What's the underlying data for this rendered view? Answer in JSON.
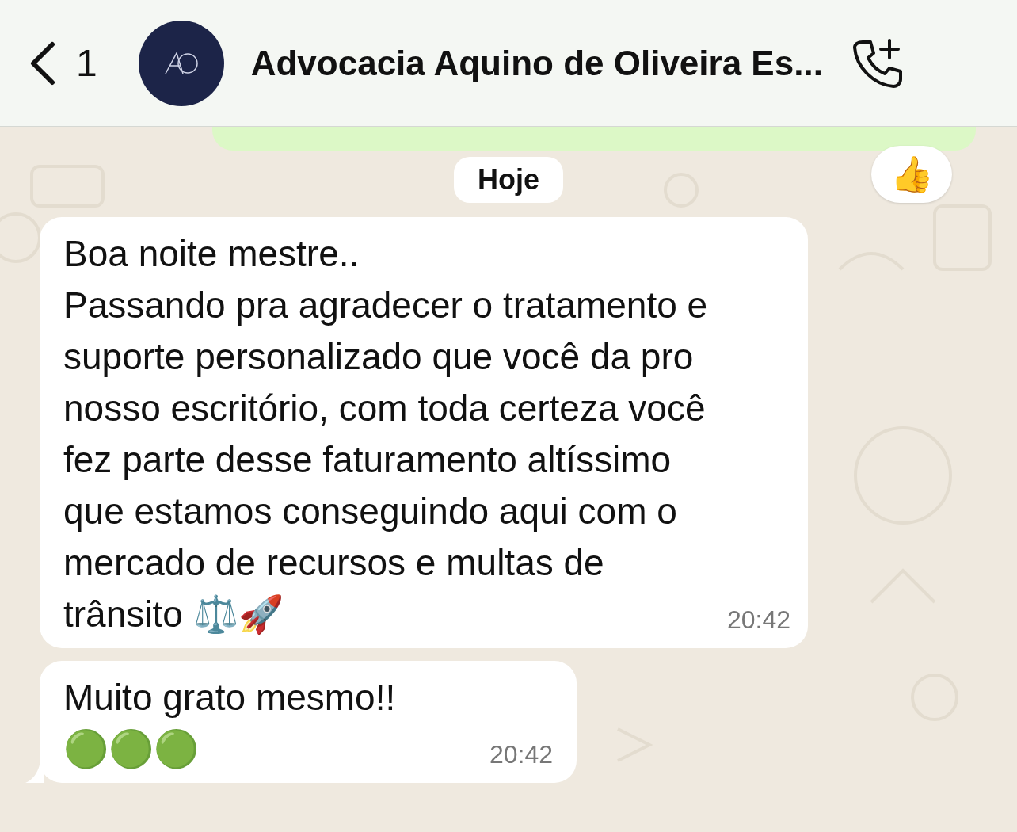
{
  "header": {
    "back_count": "1",
    "title": "Advocacia Aquino de Oliveira Es..."
  },
  "date_chip": "Hoje",
  "messages": [
    {
      "lines": [
        "Boa noite mestre..",
        "Passando pra agradecer o tratamento e suporte personalizado que você da pro nosso escritório, com toda certeza você fez parte desse faturamento altíssimo que estamos conseguindo aqui com o mercado de recursos e multas de trânsito ⚖️🚀"
      ],
      "time": "20:42",
      "tail": false
    },
    {
      "lines": [
        "Muito grato mesmo!!",
        "🟢🟢🟢"
      ],
      "time": "20:42",
      "tail": true
    }
  ],
  "reaction": "👍"
}
